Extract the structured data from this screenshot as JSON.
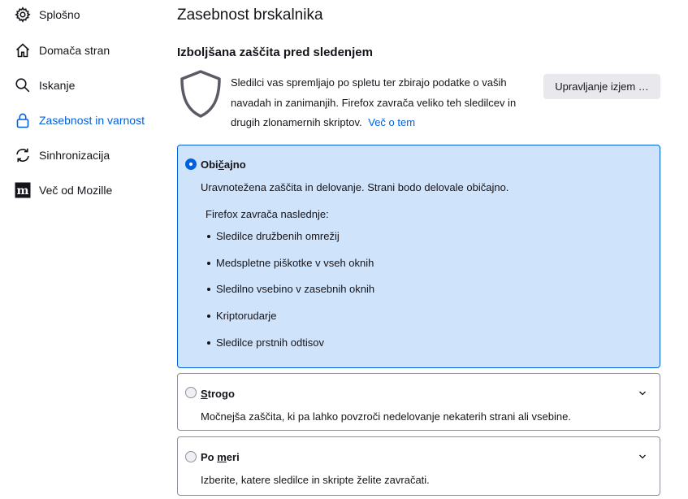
{
  "sidebar": {
    "items": [
      {
        "label": "Splošno",
        "icon": "gear-icon"
      },
      {
        "label": "Domača stran",
        "icon": "home-icon"
      },
      {
        "label": "Iskanje",
        "icon": "search-icon"
      },
      {
        "label": "Zasebnost in varnost",
        "icon": "lock-icon",
        "selected": true
      },
      {
        "label": "Sinhronizacija",
        "icon": "sync-icon"
      },
      {
        "label": "Več od Mozille",
        "icon": "mozilla-logo-icon"
      }
    ]
  },
  "main": {
    "page_title": "Zasebnost brskalnika",
    "section_title": "Izboljšana zaščita pred sledenjem",
    "intro_text": "Sledilci vas spremljajo po spletu ter zbirajo podatke o vaših navadah in zanimanjih. Firefox zavrača veliko teh sledilcev in drugih zlonamernih skriptov.",
    "learn_more": "Več o tem",
    "manage_button": "Upravljanje izjem …"
  },
  "options": {
    "standard": {
      "label_pre": "Obi",
      "label_access": "č",
      "label_post": "ajno",
      "description": "Uravnotežena zaščita in delovanje. Strani bodo delovale običajno.",
      "blocks_heading": "Firefox zavrača naslednje:",
      "blocks": [
        "Sledilce družbenih omrežij",
        "Medspletne piškotke v vseh oknih",
        "Sledilno vsebino v zasebnih oknih",
        "Kriptorudarje",
        "Sledilce prstnih odtisov"
      ],
      "checked": true
    },
    "strict": {
      "label_access": "S",
      "label_post": "trogo",
      "description": "Močnejša zaščita, ki pa lahko povzroči nedelovanje nekaterih strani ali vsebine.",
      "checked": false
    },
    "custom": {
      "label_pre": "Po ",
      "label_access": "m",
      "label_post": "eri",
      "description": "Izberite, katere sledilce in skripte želite zavračati.",
      "checked": false
    }
  },
  "colors": {
    "accent": "#0061e0",
    "selected_bg": "#cfe3fb",
    "button_bg": "#e9e9ed"
  }
}
